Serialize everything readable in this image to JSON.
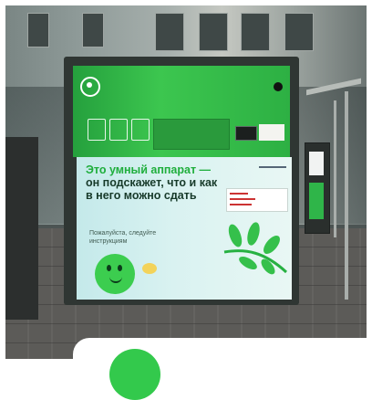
{
  "machine": {
    "headline_green": "Это умный аппарат —",
    "headline_dark": "он подскажет, что и как в него можно сдать",
    "subtext": "Пожалуйста, следуйте инструкциям"
  },
  "colors": {
    "brand_green": "#3ccd4f",
    "panel_light": "#d9f2f1",
    "headline_dark": "#173a2a"
  },
  "icons": [
    "logo-icon",
    "mascot-icon",
    "plant-icon"
  ]
}
